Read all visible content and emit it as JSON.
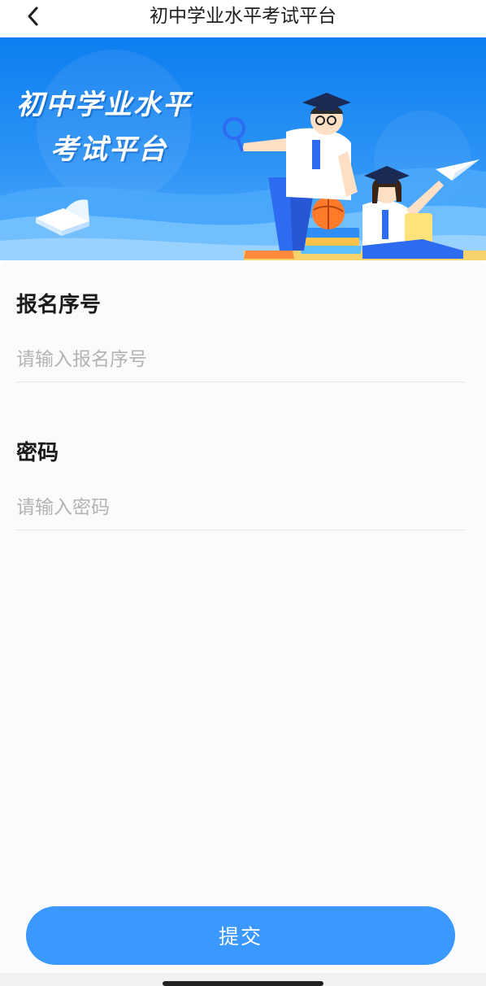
{
  "header": {
    "title": "初中学业水平考试平台",
    "back_icon": "chevron-left-icon"
  },
  "banner": {
    "title_line1": "初中学业水平",
    "title_line2": "考试平台"
  },
  "form": {
    "registration": {
      "label": "报名序号",
      "placeholder": "请输入报名序号",
      "value": ""
    },
    "password": {
      "label": "密码",
      "placeholder": "请输入密码",
      "value": ""
    },
    "submit_label": "提交"
  },
  "colors": {
    "accent": "#3a98ff",
    "banner_blue": "#0d7ef0"
  }
}
